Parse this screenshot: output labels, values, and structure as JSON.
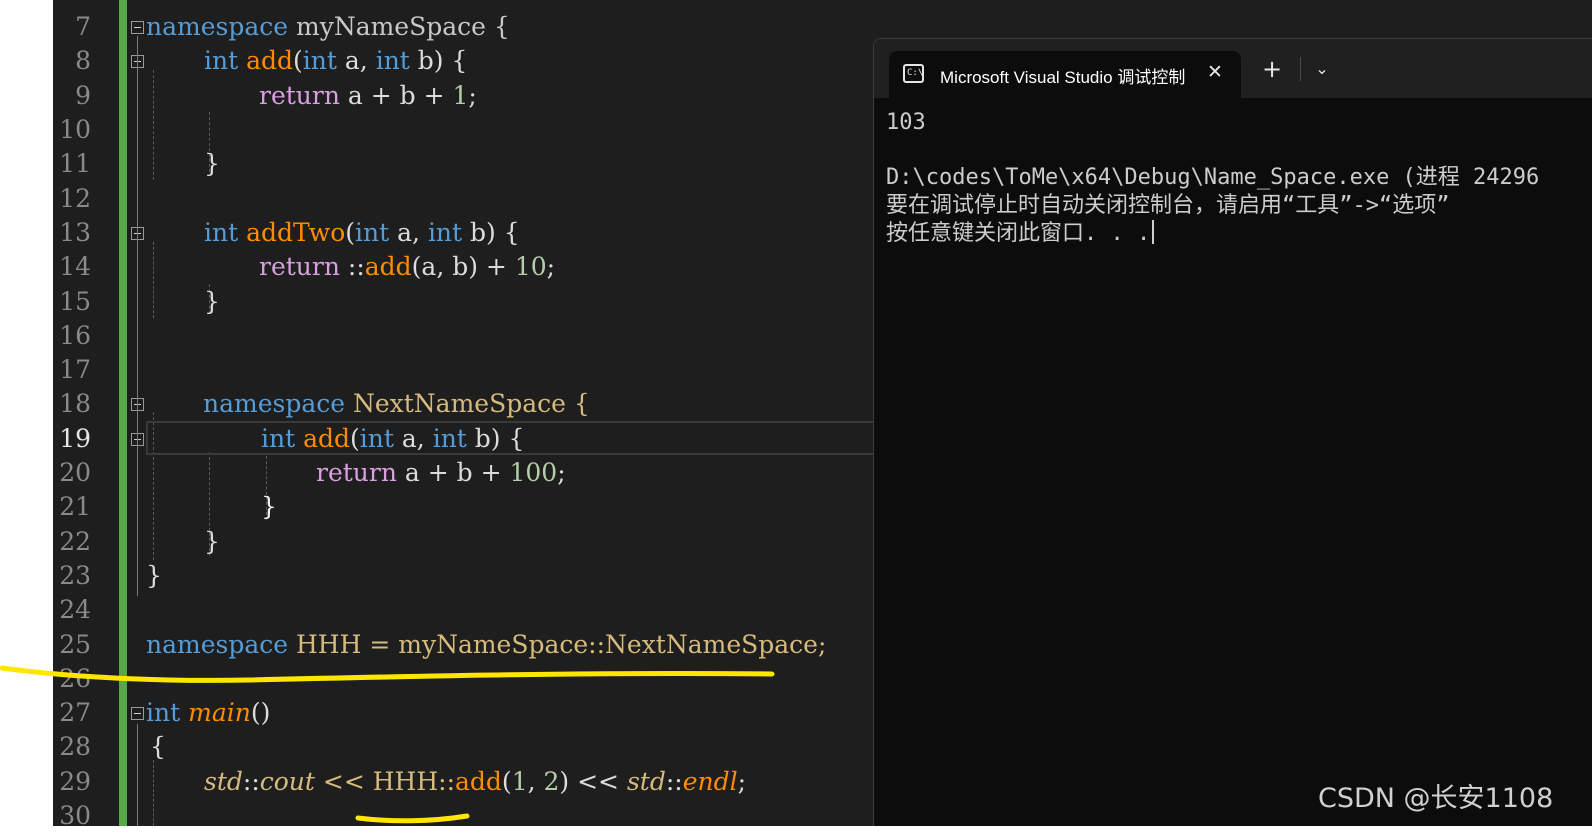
{
  "editor": {
    "line_numbers": [
      "7",
      "8",
      "9",
      "10",
      "11",
      "12",
      "13",
      "14",
      "15",
      "16",
      "17",
      "18",
      "19",
      "20",
      "21",
      "22",
      "23",
      "24",
      "25",
      "26",
      "27",
      "28",
      "29",
      "30"
    ],
    "current_line": "19",
    "code": {
      "l7": [
        "namespace",
        " myNameSpace {"
      ],
      "l8": [
        "int",
        " ",
        "add",
        "(",
        "int",
        " a, ",
        "int",
        " b) {"
      ],
      "l9": [
        "return",
        " a + b + ",
        "1",
        ";"
      ],
      "l11": [
        "}"
      ],
      "l13": [
        "int",
        " ",
        "addTwo",
        "(",
        "int",
        " a, ",
        "int",
        " b) {"
      ],
      "l14": [
        "return",
        " ::",
        "add",
        "(a, b) + ",
        "10",
        ";"
      ],
      "l15": [
        "}"
      ],
      "l18": [
        "namespace",
        " NextNameSpace {"
      ],
      "l19": [
        "int",
        " ",
        "add",
        "(",
        "int",
        " a, ",
        "int",
        " b) {"
      ],
      "l20": [
        "return",
        " a + b + ",
        "100",
        ";"
      ],
      "l21": [
        "}"
      ],
      "l22": [
        "}"
      ],
      "l23": [
        "}"
      ],
      "l25": [
        "namespace",
        " HHH = myNameSpace::NextNameSpace;"
      ],
      "l27": [
        "int",
        " ",
        "main",
        "()"
      ],
      "l28": [
        "{"
      ],
      "l29": [
        "std",
        "::",
        "cout",
        " << HHH::",
        "add",
        "(",
        "1",
        ", ",
        "2",
        ") << ",
        "std",
        "::",
        "endl",
        ";"
      ]
    }
  },
  "console": {
    "tab_title": "Microsoft Visual Studio 调试控制台",
    "tab_icon": "console-icon",
    "close_glyph": "✕",
    "new_tab_glyph": "+",
    "dropdown_glyph": "⌄",
    "output": {
      "line1": "103",
      "line2": "D:\\codes\\ToMe\\x64\\Debug\\Name_Space.exe (进程 24296",
      "line3": "要在调试停止时自动关闭控制台，请启用“工具”->“选项”",
      "line4": "按任意键关闭此窗口. . ."
    }
  },
  "watermark": "CSDN @长安1108",
  "colors": {
    "editor_bg": "#1e1e1e",
    "keyword": "#569cd6",
    "function": "#ff8c00",
    "control": "#d8a0df",
    "number": "#b5cea8",
    "change_bar": "#57a64a",
    "console_bg": "#0c0c0c",
    "highlight": "#ffe600"
  }
}
